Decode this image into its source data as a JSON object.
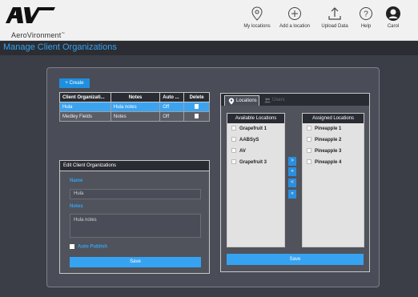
{
  "brand": {
    "wordmark": "AV",
    "company": "AeroVironment",
    "trademark": "™"
  },
  "nav": [
    {
      "label": "My locations",
      "icon": "location-pin-icon"
    },
    {
      "label": "Add a location",
      "icon": "plus-circle-icon"
    },
    {
      "label": "Upload Data",
      "icon": "upload-icon"
    },
    {
      "label": "Help",
      "icon": "help-icon"
    },
    {
      "label": "Carol",
      "icon": "user-icon"
    }
  ],
  "page_title": "Manage Client Organizations",
  "create_button": "+ Create",
  "org_table": {
    "columns": [
      "Client Organizati...",
      "Notes",
      "Auto ...",
      "Delete"
    ],
    "rows": [
      {
        "name": "Hula",
        "notes": "Hula notes",
        "auto": "Off",
        "selected": true
      },
      {
        "name": "Medley Fields",
        "notes": "Notes",
        "auto": "Off",
        "selected": false
      }
    ]
  },
  "edit_panel": {
    "title": "Edit Client Organizations",
    "name_label": "Name",
    "name_value": "Hula",
    "notes_label": "Notes",
    "notes_value": "Hula notes",
    "auto_publish_label": "Auto Publish",
    "auto_publish_checked": false,
    "save_label": "Save"
  },
  "locations_panel": {
    "tabs": [
      {
        "label": "Locations",
        "icon": "location-pin-icon",
        "active": true
      },
      {
        "label": "Users",
        "icon": "users-icon",
        "active": false
      }
    ],
    "available_title": "Available Locations",
    "available": [
      "Grapefruit 1",
      "AABSyS",
      "AV",
      "Grapefruit 3"
    ],
    "assigned_title": "Assigned Locations",
    "assigned": [
      "Pineapple 1",
      "Pineapple 2",
      "Pineapple 3",
      "Pineapple 4"
    ],
    "move_buttons": [
      ">",
      "»",
      "<",
      "«"
    ],
    "save_label": "Save"
  },
  "colors": {
    "accent": "#34a2f0",
    "header_bg": "#f1f1f1",
    "page_bg": "#3b3e47",
    "panel_bg": "#4a4d57",
    "dark_header": "#2a2c33",
    "selected_row": "#3ba4f1"
  }
}
